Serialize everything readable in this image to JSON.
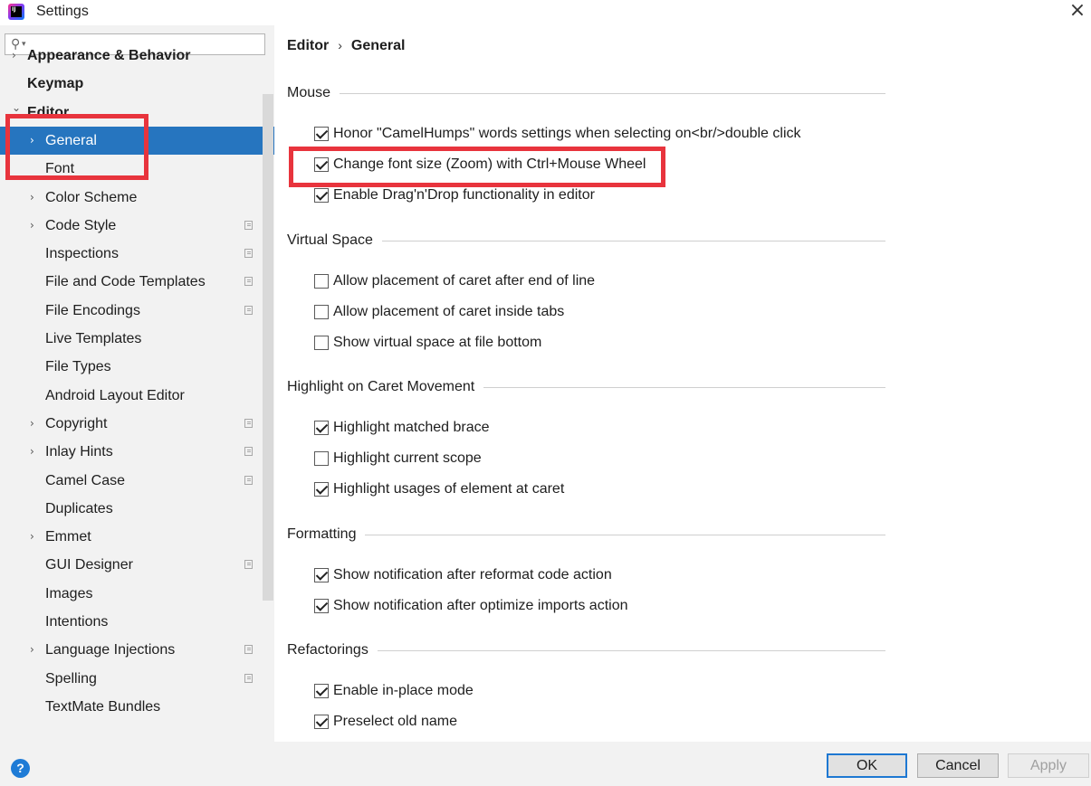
{
  "window": {
    "title": "Settings",
    "close_glyph": "×"
  },
  "search": {
    "placeholder": ""
  },
  "tree": [
    {
      "label": "Appearance & Behavior",
      "arrow": "›",
      "bold": true,
      "indent": 0
    },
    {
      "label": "Keymap",
      "arrow": "",
      "bold": true,
      "indent": 0
    },
    {
      "label": "Editor",
      "arrow": "⌄",
      "bold": true,
      "indent": 0
    },
    {
      "label": "General",
      "arrow": "›",
      "bold": false,
      "indent": 1,
      "selected": true
    },
    {
      "label": "Font",
      "arrow": "",
      "indent": 1
    },
    {
      "label": "Color Scheme",
      "arrow": "›",
      "indent": 1
    },
    {
      "label": "Code Style",
      "arrow": "›",
      "indent": 1,
      "project": true
    },
    {
      "label": "Inspections",
      "arrow": "",
      "indent": 1,
      "project": true
    },
    {
      "label": "File and Code Templates",
      "arrow": "",
      "indent": 1,
      "project": true
    },
    {
      "label": "File Encodings",
      "arrow": "",
      "indent": 1,
      "project": true
    },
    {
      "label": "Live Templates",
      "arrow": "",
      "indent": 1
    },
    {
      "label": "File Types",
      "arrow": "",
      "indent": 1
    },
    {
      "label": "Android Layout Editor",
      "arrow": "",
      "indent": 1
    },
    {
      "label": "Copyright",
      "arrow": "›",
      "indent": 1,
      "project": true
    },
    {
      "label": "Inlay Hints",
      "arrow": "›",
      "indent": 1,
      "project": true
    },
    {
      "label": "Camel Case",
      "arrow": "",
      "indent": 1,
      "project": true
    },
    {
      "label": "Duplicates",
      "arrow": "",
      "indent": 1
    },
    {
      "label": "Emmet",
      "arrow": "›",
      "indent": 1
    },
    {
      "label": "GUI Designer",
      "arrow": "",
      "indent": 1,
      "project": true
    },
    {
      "label": "Images",
      "arrow": "",
      "indent": 1
    },
    {
      "label": "Intentions",
      "arrow": "",
      "indent": 1
    },
    {
      "label": "Language Injections",
      "arrow": "›",
      "indent": 1,
      "project": true
    },
    {
      "label": "Spelling",
      "arrow": "",
      "indent": 1,
      "project": true
    },
    {
      "label": "TextMate Bundles",
      "arrow": "",
      "indent": 1
    }
  ],
  "breadcrumb": {
    "parent": "Editor",
    "separator": "›",
    "current": "General"
  },
  "sections": [
    {
      "title": "Mouse",
      "options": [
        {
          "label": "Honor \"CamelHumps\" words settings when selecting on<br/>double click",
          "checked": true
        },
        {
          "label": "Change font size (Zoom) with Ctrl+Mouse Wheel",
          "checked": true
        },
        {
          "label": "Enable Drag'n'Drop functionality in editor",
          "checked": true
        }
      ]
    },
    {
      "title": "Virtual Space",
      "options": [
        {
          "label": "Allow placement of caret after end of line",
          "checked": false
        },
        {
          "label": "Allow placement of caret inside tabs",
          "checked": false
        },
        {
          "label": "Show virtual space at file bottom",
          "checked": false
        }
      ]
    },
    {
      "title": "Highlight on Caret Movement",
      "options": [
        {
          "label": "Highlight matched brace",
          "checked": true
        },
        {
          "label": "Highlight current scope",
          "checked": false
        },
        {
          "label": "Highlight usages of element at caret",
          "checked": true
        }
      ]
    },
    {
      "title": "Formatting",
      "options": [
        {
          "label": "Show notification after reformat code action",
          "checked": true
        },
        {
          "label": "Show notification after optimize imports action",
          "checked": true
        }
      ]
    },
    {
      "title": "Refactorings",
      "options": [
        {
          "label": "Enable in-place mode",
          "checked": true
        },
        {
          "label": "Preselect old name",
          "checked": true
        }
      ]
    }
  ],
  "footer": {
    "help_glyph": "?",
    "ok": "OK",
    "cancel": "Cancel",
    "apply": "Apply"
  },
  "colors": {
    "selection": "#2675bf",
    "highlight_box": "#e8343d",
    "ok_border": "#1e78d2"
  }
}
